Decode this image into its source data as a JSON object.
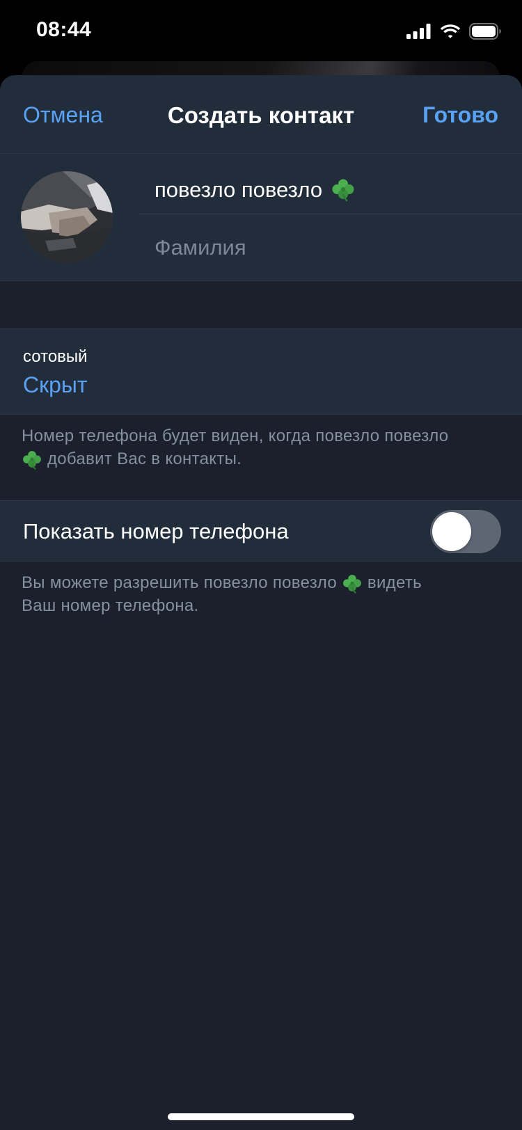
{
  "status_bar": {
    "time": "08:44",
    "icons": [
      "signal-icon",
      "wifi-icon",
      "battery-icon"
    ]
  },
  "nav": {
    "cancel_label": "Отмена",
    "title": "Создать контакт",
    "done_label": "Готово"
  },
  "contact": {
    "avatar": "contact-photo",
    "first_name": "повезло повезло",
    "first_name_emoji": "clover-icon",
    "last_name_placeholder": "Фамилия"
  },
  "phone": {
    "label": "сотовый",
    "value": "Скрыт",
    "note_lines": [
      "Номер телефона будет виден, когда повезло повезло",
      "добавит Вас в контакты."
    ]
  },
  "share_phone": {
    "label": "Показать номер телефона",
    "enabled": false,
    "note_lines": [
      "Вы можете разрешить повезло повезло",
      "видеть",
      "Ваш номер телефона."
    ]
  },
  "colors": {
    "accent": "#5aa2f4",
    "sheet_bg": "#1b202c",
    "cell_bg": "#222d3c",
    "secondary_text": "#8590a0",
    "toggle_off": "#5e6573"
  }
}
